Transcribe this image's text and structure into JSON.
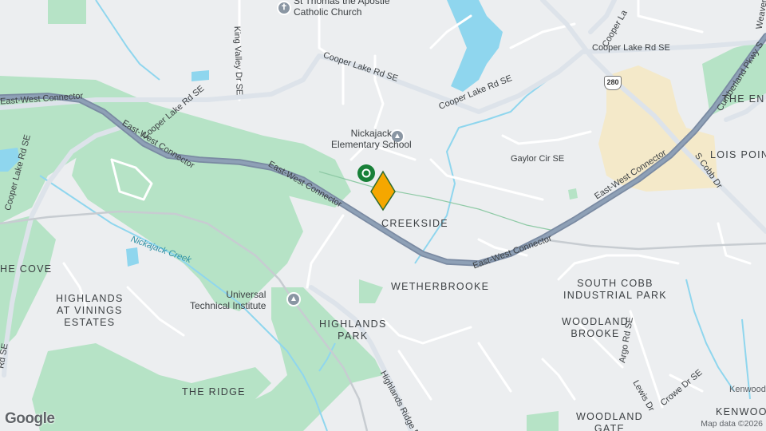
{
  "map": {
    "attribution": "Map data ©2026",
    "logo": "Google",
    "colors": {
      "park": "#b6e3c6",
      "commercial": "#f4e9c9",
      "water": "#8fd6ee",
      "highway": "#7a8aa2",
      "pin": "#f5a700",
      "transit": "#188038"
    },
    "places": {
      "church": "St Thomas the Apostle\nCatholic Church",
      "school": "Nickajack\nElementary School",
      "institute": "Universal\nTechnical Institute"
    },
    "areas": {
      "creekside": "CREEKSIDE",
      "wetherbrooke": "WETHERBROOKE",
      "south_cobb": "SOUTH COBB\nINDUSTRIAL PARK",
      "woodland_brooke": "WOODLAND\nBROOKE",
      "woodland_gate": "WOODLAND\nGATE",
      "highlands_park": "HIGHLANDS\nPARK",
      "highlands_vinings": "HIGHLANDS\nAT VININGS\nESTATES",
      "the_ridge": "THE RIDGE",
      "the_cove": "HE COVE",
      "lois_point": "LOIS POIN",
      "the_en": "THE EN",
      "kenwood_small": "Kenwood",
      "kenwood": "KENWOO"
    },
    "roads": {
      "cooper_lake_1": "Cooper Lake Rd SE",
      "cooper_lake_2": "Cooper Lake Rd SE",
      "cooper_lake_3": "Cooper Lake Rd SE",
      "cooper_lake_4": "Cooper Lake Rd SE",
      "cooper_lake_5": "Cooper La",
      "east_west_1": "East-West Connector",
      "east_west_2": "East-West Connector",
      "east_west_3": "East-West Connector",
      "east_west_4": "East-West Connector",
      "east_west_5": "East-West Connector",
      "east_west_6": "onnector",
      "king_valley": "King Valley Dr SE",
      "gaylor": "Gaylor Cir SE",
      "cumberland": "Cumberland Pkwy S",
      "s_cobb": "S Cobb Dr",
      "argo": "Argo Rd SE",
      "lewis": "Lewis Dr",
      "crowe": "Crowe Dr SE",
      "highlands_ridge": "Highlands Ridge R",
      "rd_se": "Rd SE",
      "weaver": "Weaver",
      "route": "280"
    },
    "water": {
      "nickajack": "Nickajack Creek"
    }
  }
}
